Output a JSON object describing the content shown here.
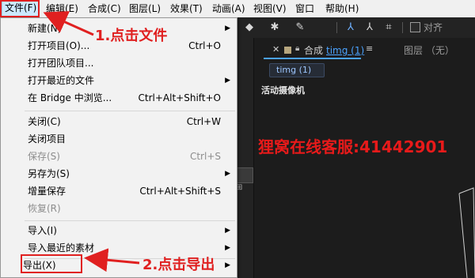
{
  "menubar": {
    "items": [
      "文件(F)",
      "编辑(E)",
      "合成(C)",
      "图层(L)",
      "效果(T)",
      "动画(A)",
      "视图(V)",
      "窗口",
      "帮助(H)"
    ]
  },
  "toolbar": {
    "align_label": "对齐",
    "align_checked": false,
    "icons": [
      "eraser-icon",
      "puppet-pin-icon",
      "pin-icon",
      "local-axis-icon",
      "world-axis-icon",
      "view-axis-icon"
    ]
  },
  "file_menu": {
    "new": {
      "label": "新建(N)",
      "submenu": true
    },
    "open_project": {
      "label": "打开项目(O)...",
      "shortcut": "Ctrl+O"
    },
    "open_team_project": {
      "label": "打开团队项目..."
    },
    "open_recent": {
      "label": "打开最近的文件",
      "submenu": true
    },
    "browse_bridge": {
      "label": "在 Bridge 中浏览...",
      "shortcut": "Ctrl+Alt+Shift+O"
    },
    "close": {
      "label": "关闭(C)",
      "shortcut": "Ctrl+W"
    },
    "close_project": {
      "label": "关闭项目"
    },
    "save": {
      "label": "保存(S)",
      "shortcut": "Ctrl+S",
      "disabled": true
    },
    "save_as": {
      "label": "另存为(S)",
      "submenu": true
    },
    "increment_save": {
      "label": "增量保存",
      "shortcut": "Ctrl+Alt+Shift+S"
    },
    "revert": {
      "label": "恢复(R)",
      "disabled": true
    },
    "import": {
      "label": "导入(I)",
      "submenu": true
    },
    "import_recent": {
      "label": "导入最近的素材",
      "submenu": true
    },
    "export": {
      "label": "导出(X)",
      "submenu": true
    }
  },
  "composition_panel": {
    "tab_prefix": "合成",
    "tab_name": "timg (1)",
    "layer_tab": "图层 （无）",
    "chip_label": "timg (1)",
    "camera_label": "活动摄像机",
    "watermark": "狸窝在线客服:41442901"
  },
  "annotations": {
    "step1": "1.点击文件",
    "step2": "2.点击导出"
  },
  "colors": {
    "annotation_red": "#e02020",
    "accent_blue": "#4ba3ff",
    "menu_bg": "#f2f2f2",
    "app_bg": "#232323"
  }
}
